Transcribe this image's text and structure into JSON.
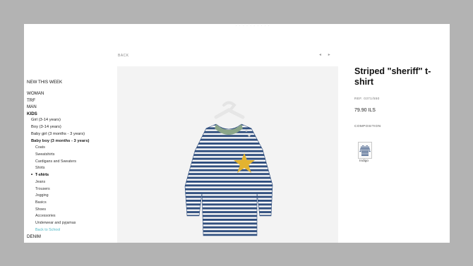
{
  "page": {
    "top_strip": "· · · · · · · · · ·"
  },
  "sidebar": {
    "new_this_week": "NEW THIS WEEK",
    "top": [
      "WOMAN",
      "TRF",
      "MAN"
    ],
    "kids": "KIDS",
    "kids_sub": [
      "Girl (3-14 years)",
      "Boy (3-14 years)",
      "Baby girl (3 months - 3 years)"
    ],
    "baby_boy": "Baby boy (3 months - 3 years)",
    "baby_boy_items_before": [
      "Coats",
      "Sweatshirts",
      "Cardigans and Sweaters",
      "Shirts"
    ],
    "active_item": "T-shirts",
    "active_bullet": "•",
    "baby_boy_items_after": [
      "Jeans",
      "Trousers",
      "Jogging",
      "Basics",
      "Shoes",
      "Accessories",
      "Underwear and pyjamas"
    ],
    "back_to_school": "Back to School",
    "denim": "DENIM"
  },
  "nav": {
    "back": "BACK",
    "prev": "◂",
    "next": "▸"
  },
  "product": {
    "title": "Striped \"sheriff\" t-shirt",
    "ref": "REF. 0371/550",
    "price": "79.90 ILS",
    "composition_label": "COMPOSITION",
    "color_name": "Indigo"
  },
  "colors": {
    "accent": "#4fb8c6",
    "stripe_navy": "#2f4e7e",
    "stripe_white": "#f7f7f7",
    "star_yellow": "#e3b330",
    "collar_green": "#8aa589"
  }
}
